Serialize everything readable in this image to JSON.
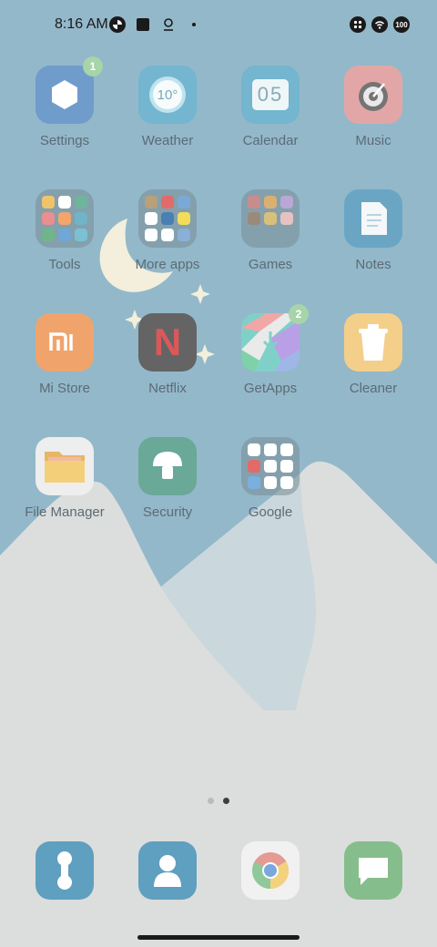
{
  "status_bar": {
    "time": "8:16 AM",
    "left_icons": [
      "pinwheel-icon",
      "square-icon",
      "location-icon",
      "dot-icon"
    ],
    "right_icons": [
      "apps-icon",
      "wifi-icon",
      "battery-icon"
    ],
    "battery": "100"
  },
  "apps": {
    "settings": {
      "label": "Settings",
      "badge": "1"
    },
    "weather": {
      "label": "Weather",
      "temp": "10°"
    },
    "calendar": {
      "label": "Calendar",
      "date": "05"
    },
    "music": {
      "label": "Music"
    },
    "tools": {
      "label": "Tools"
    },
    "more_apps": {
      "label": "More apps"
    },
    "games": {
      "label": "Games"
    },
    "notes": {
      "label": "Notes"
    },
    "mi_store": {
      "label": "Mi Store"
    },
    "netflix": {
      "label": "Netflix",
      "logo": "N"
    },
    "getapps": {
      "label": "GetApps",
      "badge": "2"
    },
    "cleaner": {
      "label": "Cleaner"
    },
    "file_manager": {
      "label": "File Manager"
    },
    "security": {
      "label": "Security"
    },
    "google": {
      "label": "Google"
    }
  },
  "dock": [
    "phone",
    "contacts",
    "chrome",
    "messages"
  ],
  "pages": {
    "count": 2,
    "active": 2
  },
  "colors": {
    "sky": "#93b8ca",
    "mountain": "#dcdedd",
    "mountain_far": "#ccd8dc",
    "moon": "#f3efdc",
    "label": "#5c6b75",
    "badge": "#a7d4a9"
  }
}
